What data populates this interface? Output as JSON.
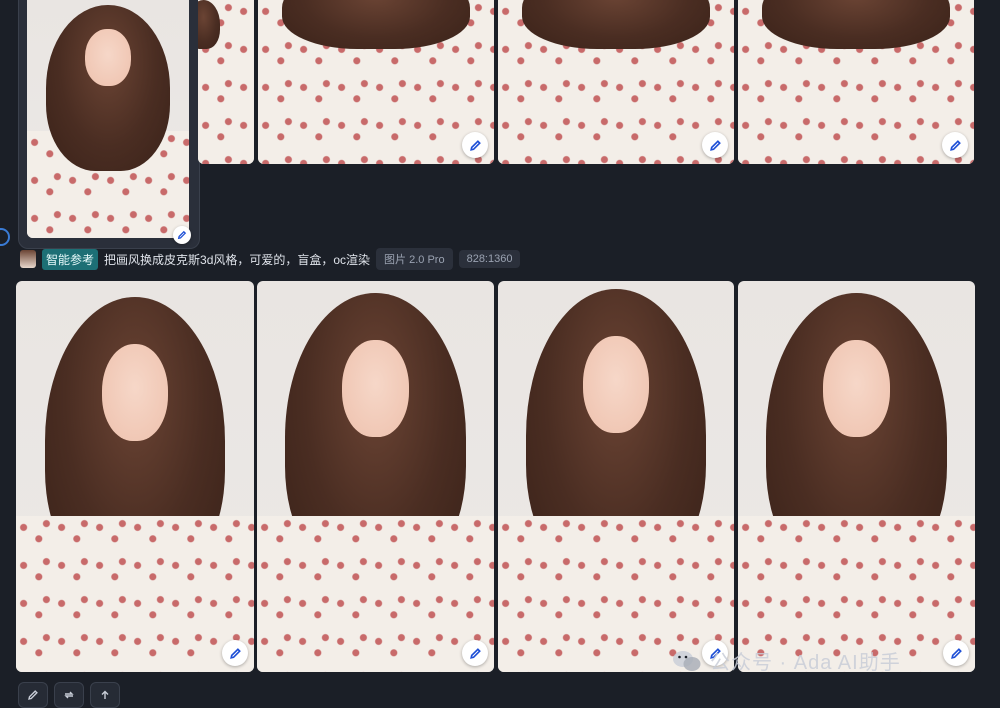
{
  "reference": {
    "tag": "智能参考",
    "prompt": "把画风换成皮克斯3d风格，可爱的，盲盒，oc渲染",
    "model": "图片 2.0 Pro",
    "ratio": "828:1360"
  },
  "watermark": {
    "text": "公众号 · Ada AI助手"
  },
  "icons": {
    "edit": "pencil-icon",
    "bottom_tools": [
      "pencil-icon",
      "regenerate-icon",
      "upload-icon"
    ],
    "watermark": "wechat-icon"
  }
}
